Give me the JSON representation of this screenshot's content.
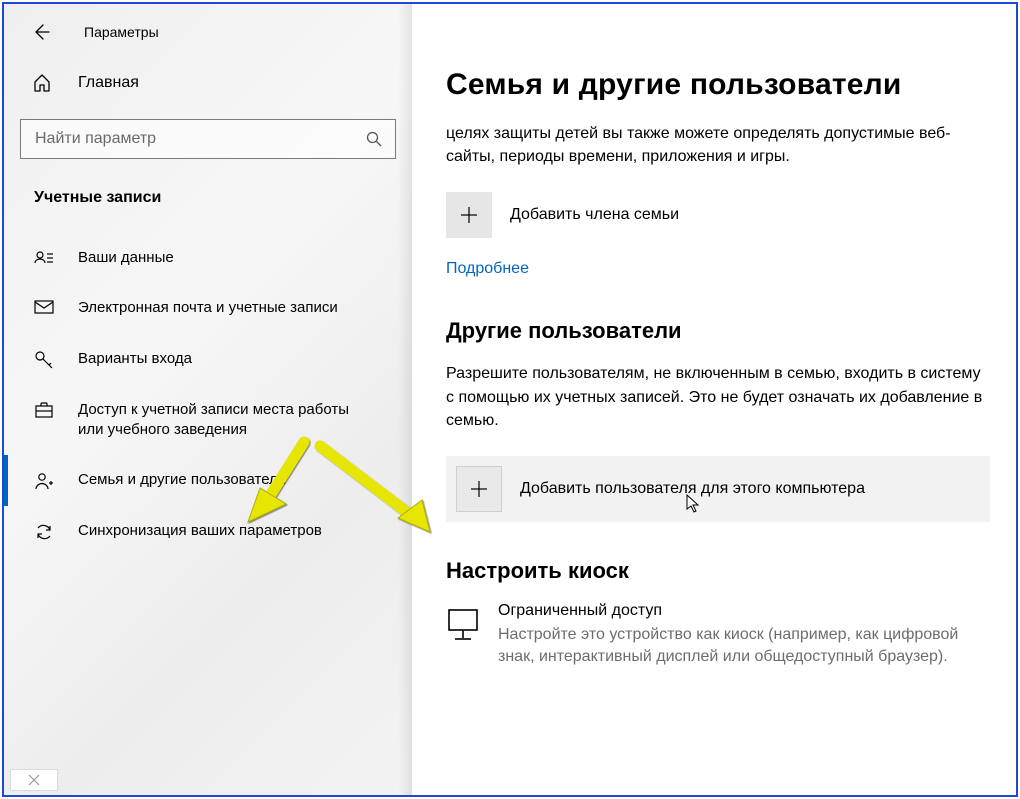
{
  "header": {
    "app_title": "Параметры",
    "home_label": "Главная"
  },
  "search": {
    "placeholder": "Найти параметр"
  },
  "section_title": "Учетные записи",
  "sidebar": {
    "items": [
      {
        "label": "Ваши данные"
      },
      {
        "label": "Электронная почта и учетные записи"
      },
      {
        "label": "Варианты входа"
      },
      {
        "label": "Доступ к учетной записи места работы или учебного заведения"
      },
      {
        "label": "Семья и другие пользователи"
      },
      {
        "label": "Синхронизация ваших параметров"
      }
    ]
  },
  "main": {
    "title": "Семья и другие пользователи",
    "family_desc": "целях защиты детей вы также можете определять допустимые веб-сайты, периоды времени, приложения и игры.",
    "add_family_label": "Добавить члена семьи",
    "more_link": "Подробнее",
    "other_title": "Другие пользователи",
    "other_desc": "Разрешите пользователям, не включенным в семью, входить в систему с помощью их учетных записей. Это не будет означать их добавление в семью.",
    "add_other_label": "Добавить пользователя для этого компьютера",
    "kiosk_title": "Настроить киоск",
    "kiosk_item_title": "Ограниченный доступ",
    "kiosk_item_desc": "Настройте это устройство как киоск (например, как цифровой знак, интерактивный дисплей или общедоступный браузер)."
  },
  "colors": {
    "accent": "#0067c0",
    "arrow": "#e6e600"
  }
}
